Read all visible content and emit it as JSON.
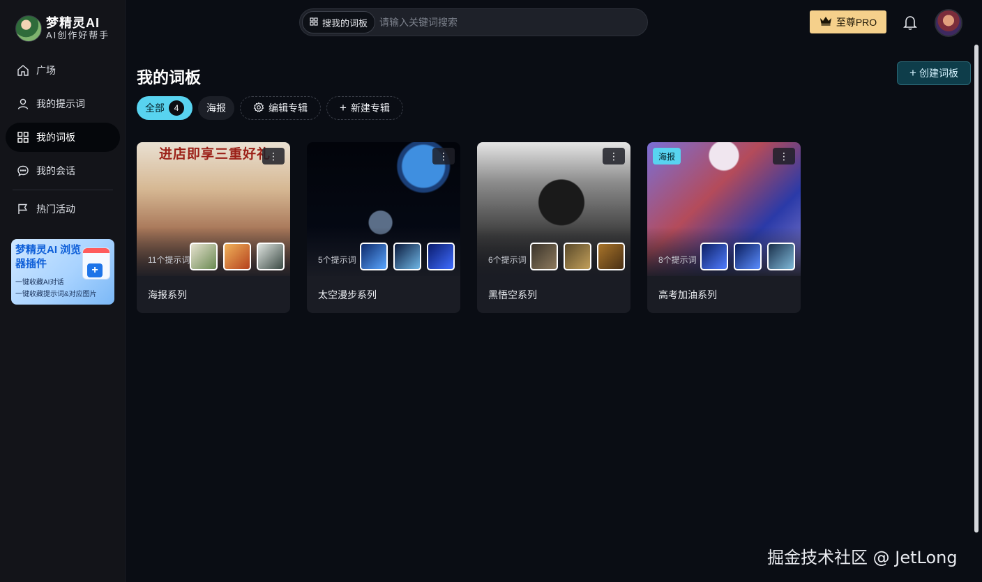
{
  "brand": {
    "title": "梦精灵AI",
    "subtitle": "AI创作好帮手"
  },
  "sidebar": {
    "items": [
      {
        "label": "广场",
        "icon": "home-icon",
        "active": false
      },
      {
        "label": "我的提示词",
        "icon": "user-icon",
        "active": false
      },
      {
        "label": "我的词板",
        "icon": "grid-icon",
        "active": true
      },
      {
        "label": "我的会话",
        "icon": "chat-icon",
        "active": false
      }
    ],
    "extra_item": {
      "label": "热门活动",
      "icon": "flag-icon"
    },
    "promo": {
      "title": "梦精灵AI 浏览器插件",
      "line1": "一键收藏AI对话",
      "line2": "一键收藏提示词&对应图片",
      "icon": "add-extension-icon"
    }
  },
  "search": {
    "scope_label": "搜我的词板",
    "placeholder": "请输入关键词搜索",
    "value": ""
  },
  "header": {
    "pro_label": "至尊PRO",
    "pro_icon": "crown-icon",
    "bell_icon": "bell-icon"
  },
  "main": {
    "title": "我的词板",
    "create_label": "创建词板",
    "tabs": [
      {
        "label": "全部",
        "badge": "4",
        "active": true
      },
      {
        "label": "海报",
        "active": false
      }
    ],
    "edit_album_label": "编辑专辑",
    "new_album_label": "新建专辑",
    "cards": [
      {
        "title": "海报系列",
        "count": "11个提示词",
        "banner_text": "进店即享三重好礼",
        "tag": ""
      },
      {
        "title": "太空漫步系列",
        "count": "5个提示词",
        "tag": ""
      },
      {
        "title": "黑悟空系列",
        "count": "6个提示词",
        "tag": ""
      },
      {
        "title": "高考加油系列",
        "count": "8个提示词",
        "tag": "海报"
      }
    ]
  },
  "watermark": "掘金技术社区 @ JetLong",
  "colors": {
    "accent": "#58d3f0",
    "pro": "#f5d08b",
    "background": "#0a0d14",
    "sidebar": "#131419"
  }
}
